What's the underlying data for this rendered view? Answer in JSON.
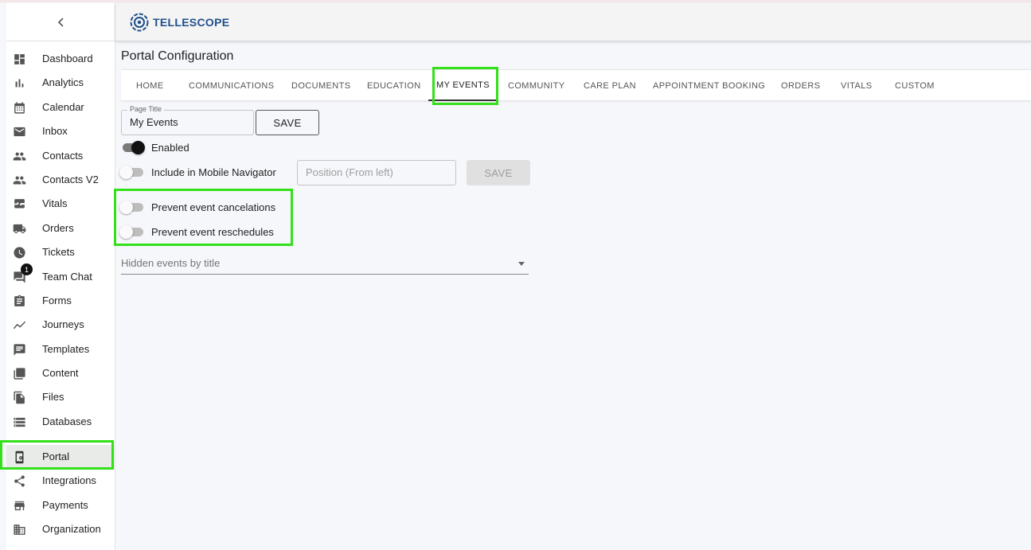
{
  "colors": {
    "highlight": "#33e01a",
    "brand": "#1f4f8b",
    "active_nav_bg": "#e8ebe8"
  },
  "brand": {
    "name": "TELLESCOPE"
  },
  "sidebar": {
    "collapse_icon": "chevron-left-icon",
    "items": [
      {
        "label": "Dashboard",
        "icon": "dashboard-icon"
      },
      {
        "label": "Analytics",
        "icon": "bar-chart-icon"
      },
      {
        "label": "Calendar",
        "icon": "calendar-icon"
      },
      {
        "label": "Inbox",
        "icon": "mail-icon"
      },
      {
        "label": "Contacts",
        "icon": "people-icon"
      },
      {
        "label": "Contacts V2",
        "icon": "people-icon"
      },
      {
        "label": "Vitals",
        "icon": "monitor-heart-icon"
      },
      {
        "label": "Orders",
        "icon": "truck-icon"
      },
      {
        "label": "Tickets",
        "icon": "clock-icon"
      },
      {
        "label": "Team Chat",
        "icon": "chat-icon",
        "badge": "1"
      },
      {
        "label": "Forms",
        "icon": "clipboard-icon"
      },
      {
        "label": "Journeys",
        "icon": "trend-icon"
      },
      {
        "label": "Templates",
        "icon": "message-icon"
      },
      {
        "label": "Content",
        "icon": "library-icon"
      },
      {
        "label": "Files",
        "icon": "file-copy-icon"
      },
      {
        "label": "Databases",
        "icon": "storage-icon"
      },
      {
        "label": "Portal",
        "icon": "phone-settings-icon",
        "active": true
      },
      {
        "label": "Integrations",
        "icon": "share-icon"
      },
      {
        "label": "Payments",
        "icon": "store-icon"
      },
      {
        "label": "Organization",
        "icon": "building-icon"
      }
    ]
  },
  "main": {
    "title": "Portal Configuration",
    "tabs": [
      {
        "label": "HOME"
      },
      {
        "label": "COMMUNICATIONS"
      },
      {
        "label": "DOCUMENTS"
      },
      {
        "label": "EDUCATION"
      },
      {
        "label": "MY EVENTS",
        "active": true
      },
      {
        "label": "COMMUNITY"
      },
      {
        "label": "CARE PLAN"
      },
      {
        "label": "APPOINTMENT BOOKING"
      },
      {
        "label": "ORDERS"
      },
      {
        "label": "VITALS"
      },
      {
        "label": "CUSTOM"
      }
    ],
    "page_title_field": {
      "label": "Page Title",
      "value": "My Events"
    },
    "save_label": "SAVE",
    "enabled": {
      "label": "Enabled",
      "checked": true
    },
    "mobile_nav": {
      "label": "Include in Mobile Navigator",
      "checked": false,
      "position_placeholder": "Position (From left)",
      "save_label": "SAVE"
    },
    "prevent_cancel": {
      "label": "Prevent event cancelations",
      "checked": false
    },
    "prevent_reschedule": {
      "label": "Prevent event reschedules",
      "checked": false
    },
    "hidden_events": {
      "label": "Hidden events by title"
    }
  }
}
